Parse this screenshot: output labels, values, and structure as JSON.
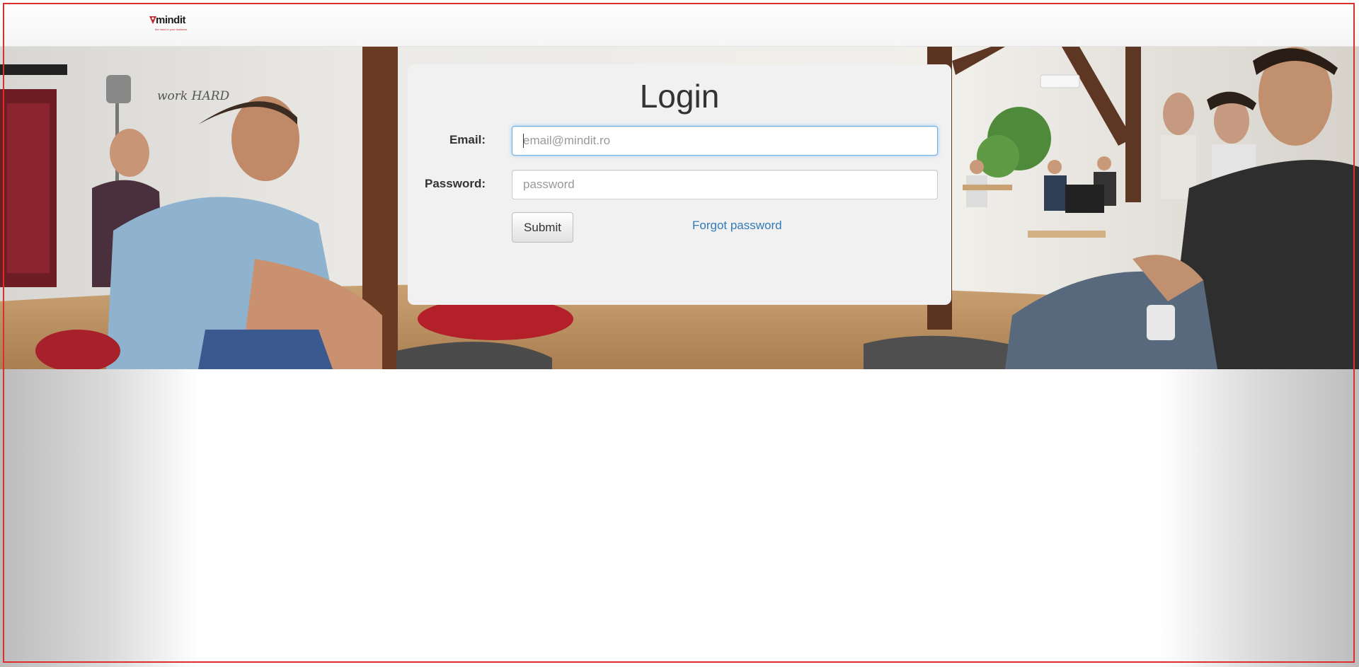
{
  "header": {
    "logo_text": "mindit",
    "logo_tagline": "the mind in your business"
  },
  "hero": {
    "wall_text": "work HARD"
  },
  "login": {
    "title": "Login",
    "email_label": "Email:",
    "email_placeholder": "email@mindit.ro",
    "email_value": "",
    "password_label": "Password:",
    "password_placeholder": "password",
    "password_value": "",
    "submit_label": "Submit",
    "forgot_label": "Forgot password"
  },
  "colors": {
    "brand_red": "#c1272d",
    "link_blue": "#337ab7",
    "focus_blue": "#66afe9",
    "panel_bg": "#f1f1f1"
  }
}
